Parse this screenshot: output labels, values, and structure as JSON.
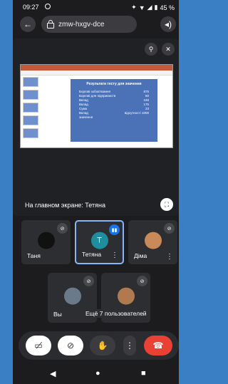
{
  "status_bar": {
    "time": "09:27",
    "battery": "45 %"
  },
  "header": {
    "meeting_code": "zmw-hxgv-dce"
  },
  "presentation": {
    "caption": "На главном экране: Тетяна",
    "slide_title": "Результати тесту для значення",
    "slide_rows": [
      {
        "label": "Боргові зобов'язання",
        "value": "875"
      },
      {
        "label": "Боргові для підприємств",
        "value": "60"
      },
      {
        "label": "Вклад",
        "value": "248"
      },
      {
        "label": "Вклад",
        "value": "175"
      },
      {
        "label": "Сума",
        "value": "23"
      },
      {
        "label": "Вклад",
        "value": "відсутності 1000"
      }
    ],
    "slide_footer": "значення"
  },
  "participants": [
    {
      "name": "Таня",
      "avatar_color": "#111111"
    },
    {
      "name": "Тетяна",
      "initial": "T",
      "avatar_color": "#1e8e9e",
      "speaking": true
    },
    {
      "name": "Діма",
      "avatar_color": "#c98a5a"
    },
    {
      "name": "Вы",
      "avatar_color": "#6b7a8a"
    },
    {
      "name": "",
      "avatar_color": "#b07a50"
    }
  ],
  "overflow_label": "Ещё 7 пользователей",
  "controls": {
    "camera": "camera-off-icon",
    "mic": "mic-off-icon",
    "hand": "raise-hand-icon",
    "more": "more-icon",
    "end_call": "end-call-icon"
  },
  "colors": {
    "end_call": "#e94235",
    "speaking_border": "#8ab4f8",
    "accent": "#1e8e9e"
  }
}
